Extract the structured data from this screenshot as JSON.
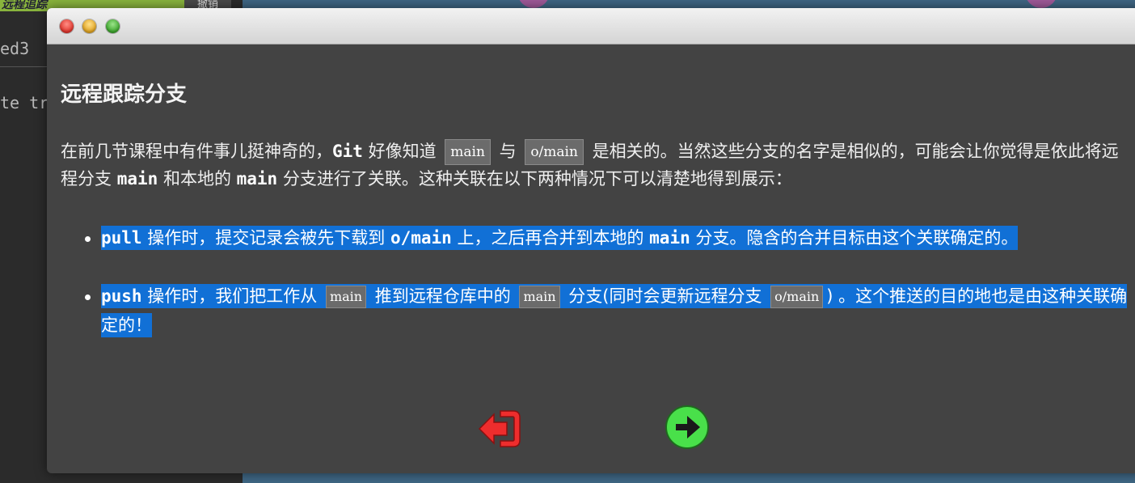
{
  "background": {
    "tab_label": "远程追踪",
    "button_label": "撤销",
    "code_lines": [
      "ed3",
      "te tr"
    ]
  },
  "dialog": {
    "title": "远程跟踪分支",
    "intro": {
      "p1": "在前几节课程中有件事儿挺神奇的，",
      "git": "Git",
      "p2": " 好像知道 ",
      "tag1": "main",
      "p3": " 与 ",
      "tag2": "o/main",
      "p4": " 是相关的。当然这些分支的名字是相似的，可能会让你觉得是依此将远程分支 ",
      "code1": "main",
      "p5": " 和本地的 ",
      "code2": "main",
      "p6": " 分支进行了关联。这种关联在以下两种情况下可以清楚地得到展示："
    },
    "points": [
      {
        "cmd": "pull",
        "t1": " 操作时，提交记录会被先下载到 ",
        "c1": "o/main",
        "t2": " 上，之后再合并到本地的 ",
        "c2": "main",
        "t3": " 分支。隐含的合并目标由这个关联确定的。"
      },
      {
        "cmd": "push",
        "t1": " 操作时，我们把工作从 ",
        "tag1": "main",
        "t2": " 推到远程仓库中的 ",
        "tag2": "main",
        "t3": " 分支(同时会更新远程分支 ",
        "tag3": "o/main",
        "t4": ") 。这个推送的目的地也是由这种关联确定的！"
      }
    ],
    "nav": {
      "back_icon": "exit-left-icon",
      "next_icon": "arrow-right-circle-icon"
    }
  },
  "colors": {
    "window_bg": "#434343",
    "selection": "#1170d6",
    "back": "#ee2d2d",
    "next": "#49e04a"
  }
}
